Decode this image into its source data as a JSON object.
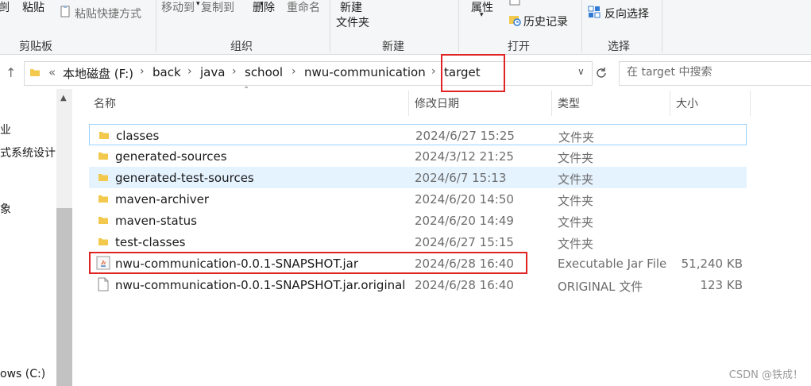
{
  "ribbon": {
    "clipboard": {
      "paste": "粘贴",
      "paste_shortcut": "粘贴快捷方式",
      "group": "剪贴板"
    },
    "organize": {
      "move_to": "移动到",
      "copy_to": "复制到",
      "delete": "删除",
      "rename": "重命名",
      "group": "组织"
    },
    "new": {
      "new_folder": "新建\n文件夹",
      "new_folder_l1": "新建",
      "new_folder_l2": "文件夹",
      "group": "新建"
    },
    "open": {
      "properties": "属性",
      "history": "历史记录",
      "group": "打开"
    },
    "select": {
      "invert": "反向选择",
      "group": "选择"
    }
  },
  "address": {
    "prefix": "«",
    "crumbs": [
      "本地磁盘 (F:)",
      "back",
      "java",
      "school",
      "nwu-communication",
      "target"
    ]
  },
  "search": {
    "placeholder": "在 target 中搜索"
  },
  "nav": {
    "items": [
      "业",
      "式系统设计",
      "象",
      "ows (C:)"
    ]
  },
  "columns": {
    "name": "名称",
    "date": "修改日期",
    "type": "类型",
    "size": "大小"
  },
  "files": [
    {
      "name": "classes",
      "date": "2024/6/27 15:25",
      "type": "文件夹",
      "size": "",
      "icon": "folder-icon"
    },
    {
      "name": "generated-sources",
      "date": "2024/3/12 21:25",
      "type": "文件夹",
      "size": "",
      "icon": "folder-icon"
    },
    {
      "name": "generated-test-sources",
      "date": "2024/6/7 15:13",
      "type": "文件夹",
      "size": "",
      "icon": "folder-icon"
    },
    {
      "name": "maven-archiver",
      "date": "2024/6/20 14:50",
      "type": "文件夹",
      "size": "",
      "icon": "folder-icon"
    },
    {
      "name": "maven-status",
      "date": "2024/6/20 14:49",
      "type": "文件夹",
      "size": "",
      "icon": "folder-icon"
    },
    {
      "name": "test-classes",
      "date": "2024/6/27 15:15",
      "type": "文件夹",
      "size": "",
      "icon": "folder-icon"
    },
    {
      "name": "nwu-communication-0.0.1-SNAPSHOT.jar",
      "date": "2024/6/28 16:40",
      "type": "Executable Jar File",
      "size": "51,240 KB",
      "icon": "java-jar-icon"
    },
    {
      "name": "nwu-communication-0.0.1-SNAPSHOT.jar.original",
      "date": "2024/6/28 16:40",
      "type": "ORIGINAL 文件",
      "size": "123 KB",
      "icon": "file-icon"
    }
  ],
  "watermark": "CSDN @铁成！",
  "colors": {
    "folder": "#f2c94c",
    "highlight": "#e02424",
    "selection_border": "#99d1ff",
    "hover": "#e5f3ff"
  }
}
